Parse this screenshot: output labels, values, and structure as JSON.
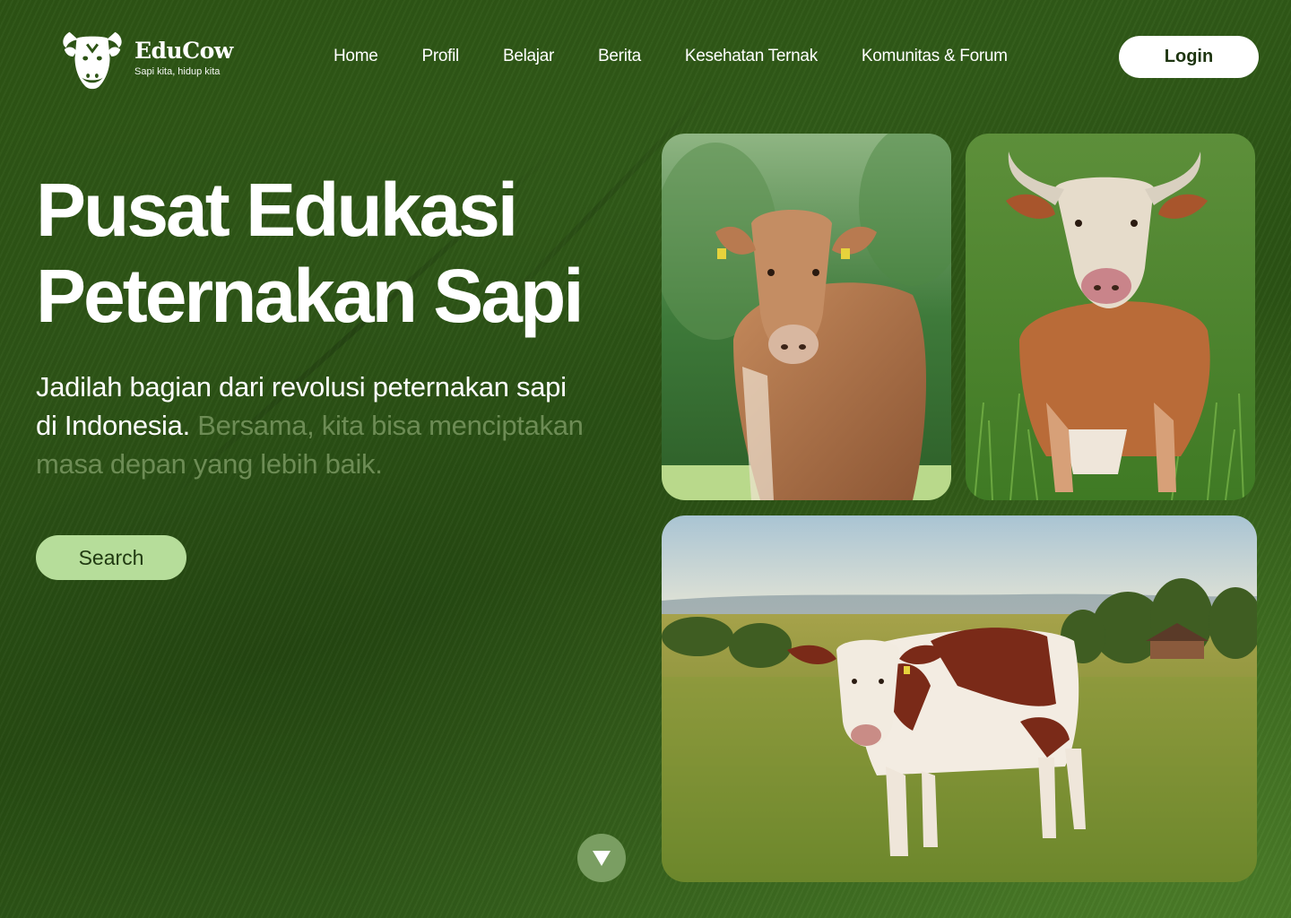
{
  "brand": {
    "name": "EduCow",
    "tagline": "Sapi kita, hidup kita",
    "logo_icon": "cow-head-icon"
  },
  "nav": {
    "items": [
      {
        "label": "Home"
      },
      {
        "label": "Profil"
      },
      {
        "label": "Belajar"
      },
      {
        "label": "Berita"
      },
      {
        "label": "Kesehatan Ternak"
      },
      {
        "label": "Komunitas & Forum"
      }
    ],
    "login_label": "Login"
  },
  "hero": {
    "title_line1": "Pusat Edukasi",
    "title_line2": "Peternakan Sapi",
    "subtitle_bright": "Jadilah bagian dari revolusi peternakan sapi di Indonesia.",
    "subtitle_dim": "Bersama, kita bisa menciptakan masa depan yang lebih baik.",
    "search_label": "Search",
    "scroll_icon": "chevron-down-icon"
  },
  "gallery": {
    "photos": [
      {
        "subject": "brown cow in green field"
      },
      {
        "subject": "horned brown and white cow in tall grass"
      },
      {
        "subject": "spotted cow in pasture with village behind"
      }
    ]
  },
  "colors": {
    "background": "#2c5314",
    "search_button": "#b6dd9a",
    "scroll_button": "#7a9e62",
    "dim_text": "#6d8c55"
  }
}
